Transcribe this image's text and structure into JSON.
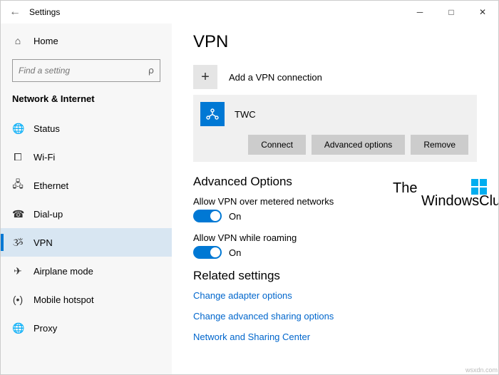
{
  "window": {
    "title": "Settings"
  },
  "sidebar": {
    "home": "Home",
    "search_placeholder": "Find a setting",
    "category": "Network & Internet",
    "items": [
      {
        "label": "Status"
      },
      {
        "label": "Wi-Fi"
      },
      {
        "label": "Ethernet"
      },
      {
        "label": "Dial-up"
      },
      {
        "label": "VPN"
      },
      {
        "label": "Airplane mode"
      },
      {
        "label": "Mobile hotspot"
      },
      {
        "label": "Proxy"
      }
    ]
  },
  "main": {
    "title": "VPN",
    "add_label": "Add a VPN connection",
    "vpn_name": "TWC",
    "btn_connect": "Connect",
    "btn_advanced": "Advanced options",
    "btn_remove": "Remove",
    "adv_section": "Advanced Options",
    "metered_label": "Allow VPN over metered networks",
    "metered_state": "On",
    "roaming_label": "Allow VPN while roaming",
    "roaming_state": "On",
    "related_section": "Related settings",
    "link_adapter": "Change adapter options",
    "link_sharing": "Change advanced sharing options",
    "link_center": "Network and Sharing Center"
  },
  "watermark": {
    "line1": "The",
    "line2": "WindowsClub"
  },
  "footer_url": "wsxdn.com"
}
